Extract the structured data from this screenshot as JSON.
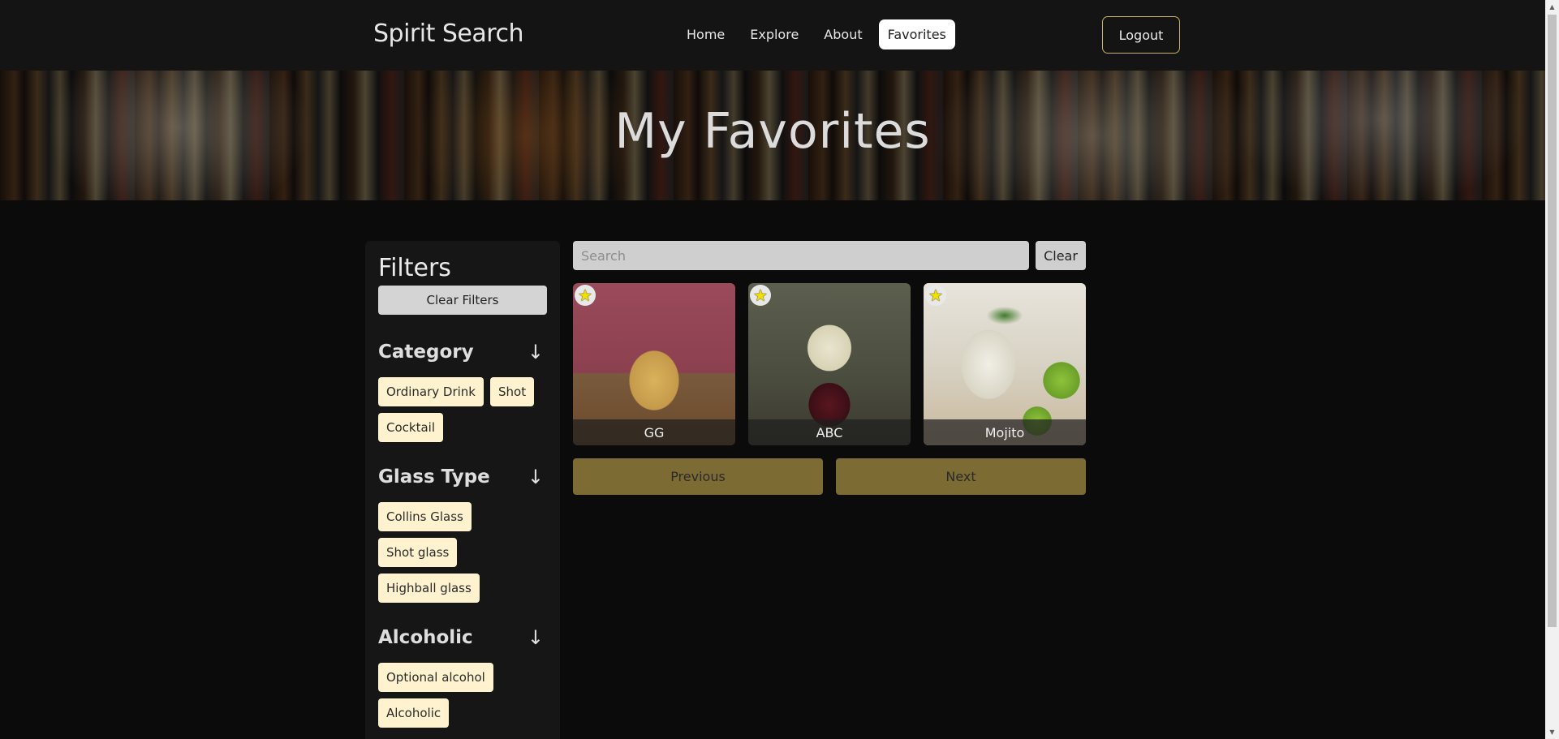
{
  "navbar": {
    "brand": "Spirit Search",
    "links": [
      "Home",
      "Explore",
      "About",
      "Favorites"
    ],
    "active_link": "Favorites",
    "logout_label": "Logout"
  },
  "hero": {
    "title": "My Favorites"
  },
  "sidebar": {
    "title": "Filters",
    "clear_label": "Clear Filters",
    "sections": [
      {
        "title": "Category",
        "icon": "arrow-down-icon",
        "chips": [
          "Ordinary Drink",
          "Shot",
          "Cocktail"
        ]
      },
      {
        "title": "Glass Type",
        "icon": "arrow-down-icon",
        "chips": [
          "Collins Glass",
          "Shot glass",
          "Highball glass"
        ]
      },
      {
        "title": "Alcoholic",
        "icon": "arrow-down-icon",
        "chips": [
          "Optional alcohol",
          "Alcoholic"
        ]
      }
    ]
  },
  "search": {
    "placeholder": "Search",
    "value": "",
    "clear_label": "Clear"
  },
  "cards": [
    {
      "name": "GG",
      "favorited": true,
      "icon": "star-icon"
    },
    {
      "name": "ABC",
      "favorited": true,
      "icon": "star-icon"
    },
    {
      "name": "Mojito",
      "favorited": true,
      "icon": "star-icon"
    }
  ],
  "pager": {
    "previous_label": "Previous",
    "next_label": "Next"
  },
  "colors": {
    "accent_gold": "#7d6b34",
    "chip_bg": "#fff3cf",
    "logout_border": "#c9b262",
    "star": "#f2e000"
  }
}
